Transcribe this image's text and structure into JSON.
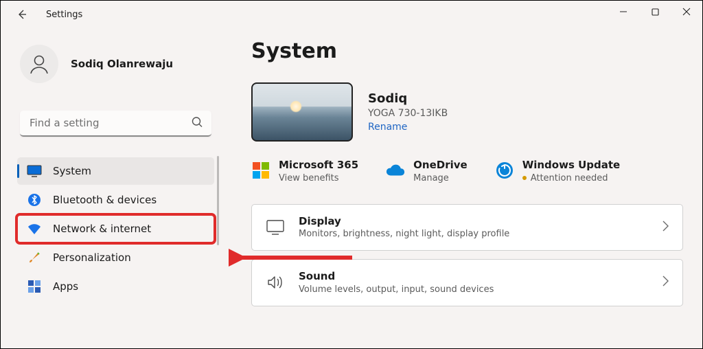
{
  "titlebar": {
    "app": "Settings"
  },
  "profile": {
    "name": "Sodiq Olanrewaju"
  },
  "search": {
    "placeholder": "Find a setting"
  },
  "nav": {
    "items": [
      {
        "label": "System"
      },
      {
        "label": "Bluetooth & devices"
      },
      {
        "label": "Network & internet"
      },
      {
        "label": "Personalization"
      },
      {
        "label": "Apps"
      }
    ]
  },
  "page": {
    "title": "System"
  },
  "device": {
    "name": "Sodiq",
    "model": "YOGA 730-13IKB",
    "rename": "Rename"
  },
  "services": {
    "m365": {
      "title": "Microsoft 365",
      "sub": "View benefits"
    },
    "onedrive": {
      "title": "OneDrive",
      "sub": "Manage"
    },
    "update": {
      "title": "Windows Update",
      "sub": "Attention needed"
    }
  },
  "cards": {
    "display": {
      "title": "Display",
      "sub": "Monitors, brightness, night light, display profile"
    },
    "sound": {
      "title": "Sound",
      "sub": "Volume levels, output, input, sound devices"
    }
  }
}
